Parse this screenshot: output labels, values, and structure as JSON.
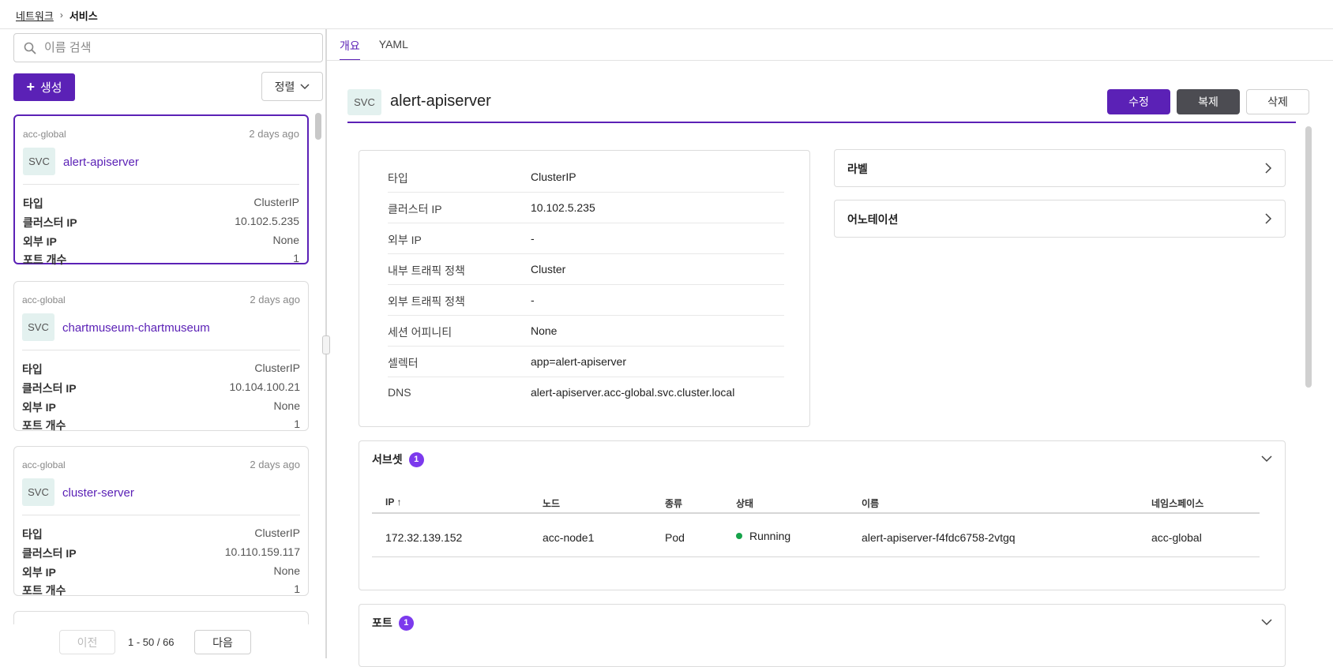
{
  "breadcrumb": {
    "parent": "네트워크",
    "current": "서비스"
  },
  "left": {
    "search_placeholder": "이름 검색",
    "create_label": "생성",
    "sort_label": "정렬",
    "cards": [
      {
        "namespace": "acc-global",
        "age": "2 days ago",
        "badge": "SVC",
        "name": "alert-apiserver",
        "props": [
          {
            "k": "타입",
            "v": "ClusterIP"
          },
          {
            "k": "클러스터 IP",
            "v": "10.102.5.235"
          },
          {
            "k": "외부 IP",
            "v": "None"
          },
          {
            "k": "포트 개수",
            "v": "1"
          }
        ]
      },
      {
        "namespace": "acc-global",
        "age": "2 days ago",
        "badge": "SVC",
        "name": "chartmuseum-chartmuseum",
        "props": [
          {
            "k": "타입",
            "v": "ClusterIP"
          },
          {
            "k": "클러스터 IP",
            "v": "10.104.100.21"
          },
          {
            "k": "외부 IP",
            "v": "None"
          },
          {
            "k": "포트 개수",
            "v": "1"
          }
        ]
      },
      {
        "namespace": "acc-global",
        "age": "2 days ago",
        "badge": "SVC",
        "name": "cluster-server",
        "props": [
          {
            "k": "타입",
            "v": "ClusterIP"
          },
          {
            "k": "클러스터 IP",
            "v": "10.110.159.117"
          },
          {
            "k": "외부 IP",
            "v": "None"
          },
          {
            "k": "포트 개수",
            "v": "1"
          }
        ]
      }
    ],
    "pagination": {
      "prev": "이전",
      "range": "1 - 50 / 66",
      "next": "다음"
    }
  },
  "tabs": [
    {
      "label": "개요"
    },
    {
      "label": "YAML"
    }
  ],
  "detail": {
    "badge": "SVC",
    "title": "alert-apiserver",
    "edit_label": "수정",
    "clone_label": "복제",
    "delete_label": "삭제",
    "info": [
      {
        "k": "타입",
        "v": "ClusterIP"
      },
      {
        "k": "클러스터 IP",
        "v": "10.102.5.235"
      },
      {
        "k": "외부 IP",
        "v": "-"
      },
      {
        "k": "내부 트래픽 정책",
        "v": "Cluster"
      },
      {
        "k": "외부 트래픽 정책",
        "v": "-"
      },
      {
        "k": "세션 어피니티",
        "v": "None"
      },
      {
        "k": "셀렉터",
        "v": "app=alert-apiserver"
      },
      {
        "k": "DNS",
        "v": "alert-apiserver.acc-global.svc.cluster.local"
      }
    ],
    "labels_title": "라벨",
    "annotations_title": "어노테이션",
    "subset": {
      "title": "서브셋",
      "count": "1",
      "columns": [
        "IP",
        "노드",
        "종류",
        "상태",
        "이름",
        "네임스페이스"
      ],
      "rows": [
        [
          "172.32.139.152",
          "acc-node1",
          "Pod",
          "Running",
          "alert-apiserver-f4fdc6758-2vtgq",
          "acc-global"
        ]
      ]
    },
    "ports": {
      "title": "포트",
      "count": "1"
    }
  },
  "colors": {
    "accent": "#5b21b6",
    "badge_purple": "#7c3aed",
    "status_running": "#16a34a",
    "clone_button": "#4c4c52"
  }
}
